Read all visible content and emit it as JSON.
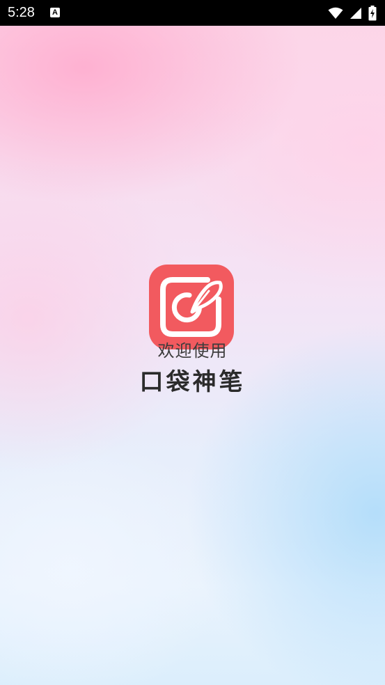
{
  "status_bar": {
    "time": "5:28",
    "notification_icon": "A",
    "icons": [
      "wifi-icon",
      "cellular-signal-icon",
      "battery-charging-icon"
    ]
  },
  "splash": {
    "welcome": "欢迎使用",
    "app_name": "口袋神笔",
    "icon": "app-logo-icon"
  },
  "colors": {
    "icon_bg": "#f25a5f",
    "text_primary": "#2b2b2b",
    "status_bar_bg": "#000000"
  }
}
